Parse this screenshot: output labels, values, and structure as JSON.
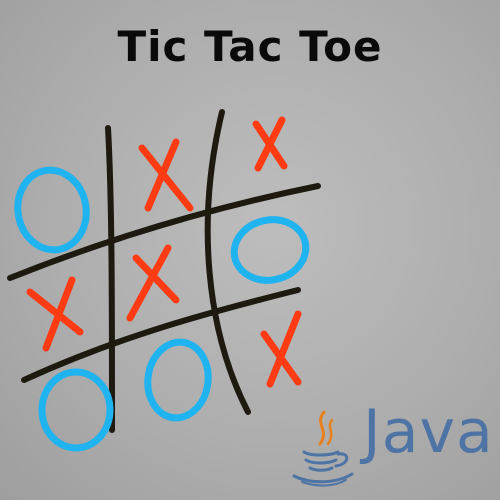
{
  "title": "Tic Tac Toe",
  "logo": {
    "wordmark": "Java",
    "icon": "coffee-cup-icon"
  },
  "board": {
    "cells": [
      [
        "O",
        "X",
        "X"
      ],
      [
        "X",
        "X",
        "O"
      ],
      [
        "O",
        "O",
        "X"
      ]
    ]
  },
  "colors": {
    "x": "#ff3b14",
    "o": "#1fb3ef",
    "grid": "#1e1a10",
    "java_blue": "#4d74a5",
    "java_orange": "#e8801c"
  }
}
